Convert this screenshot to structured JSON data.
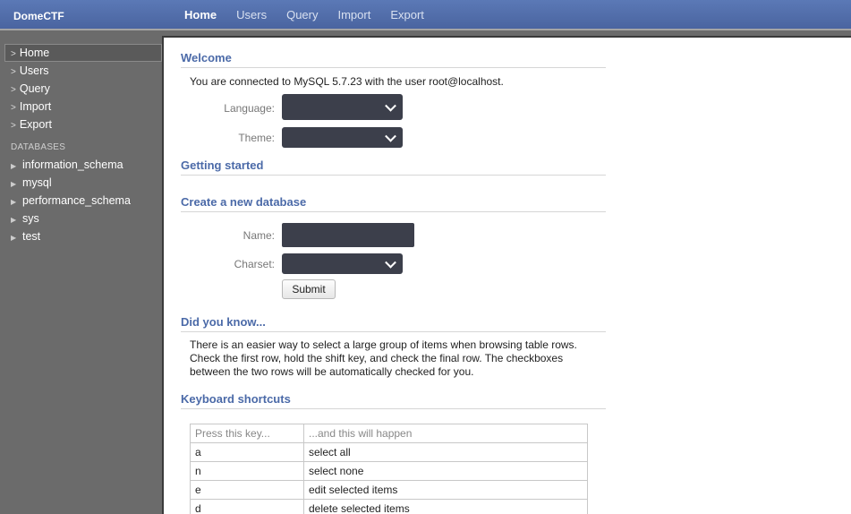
{
  "topbar": {
    "brand": "DomeCTF",
    "nav": [
      {
        "label": "Home",
        "active": true
      },
      {
        "label": "Users",
        "active": false
      },
      {
        "label": "Query",
        "active": false
      },
      {
        "label": "Import",
        "active": false
      },
      {
        "label": "Export",
        "active": false
      }
    ]
  },
  "sidebar": {
    "items": [
      {
        "label": "Home",
        "active": true
      },
      {
        "label": "Users",
        "active": false
      },
      {
        "label": "Query",
        "active": false
      },
      {
        "label": "Import",
        "active": false
      },
      {
        "label": "Export",
        "active": false
      }
    ],
    "chevron": ">",
    "databases_heading": "DATABASES",
    "databases": [
      "information_schema",
      "mysql",
      "performance_schema",
      "sys",
      "test"
    ]
  },
  "welcome": {
    "title": "Welcome",
    "connection_text": "You are connected to MySQL 5.7.23 with the user root@localhost.",
    "language_label": "Language:",
    "theme_label": "Theme:"
  },
  "getting_started": {
    "title": "Getting started"
  },
  "create_db": {
    "title": "Create a new database",
    "name_label": "Name:",
    "name_value": "",
    "charset_label": "Charset:",
    "submit_label": "Submit"
  },
  "did_you_know": {
    "title": "Did you know...",
    "text": "There is an easier way to select a large group of items when browsing table rows. Check the first row, hold the shift key, and check the final row. The checkboxes between the two rows will be automatically checked for you."
  },
  "shortcuts": {
    "title": "Keyboard shortcuts",
    "headers": [
      "Press this key...",
      "...and this will happen"
    ],
    "rows": [
      [
        "a",
        "select all"
      ],
      [
        "n",
        "select none"
      ],
      [
        "e",
        "edit selected items"
      ],
      [
        "d",
        "delete selected items"
      ]
    ]
  },
  "colors": {
    "header_bar": "#4a64a0",
    "section_title": "#4b6aa8",
    "sidebar_bg": "#6b6b6b",
    "control_bg": "#3c3f4b"
  }
}
